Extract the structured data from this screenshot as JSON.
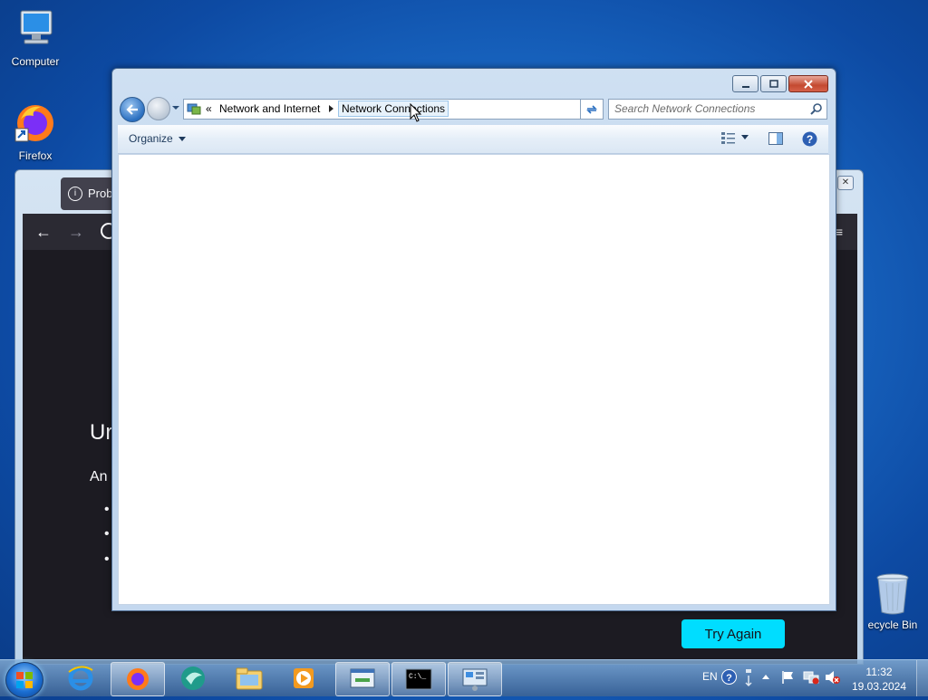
{
  "desktop": {
    "icons": [
      {
        "label": "Computer"
      },
      {
        "label": "Firefox"
      }
    ],
    "recycle_bin": "ecycle Bin"
  },
  "firefox": {
    "notification": "Prob",
    "heading": "Ur",
    "para": "An",
    "try_again": "Try Again"
  },
  "explorer": {
    "breadcrumb": {
      "overflow": "«",
      "items": [
        "Network and Internet",
        "Network Connections"
      ]
    },
    "search_placeholder": "Search Network Connections",
    "organize": "Organize"
  },
  "taskbar": {
    "language": "EN",
    "time": "11:32",
    "date": "19.03.2024"
  },
  "colors": {
    "try_again_bg": "#00ddff",
    "desktop_bg": "#1b6cc8"
  }
}
